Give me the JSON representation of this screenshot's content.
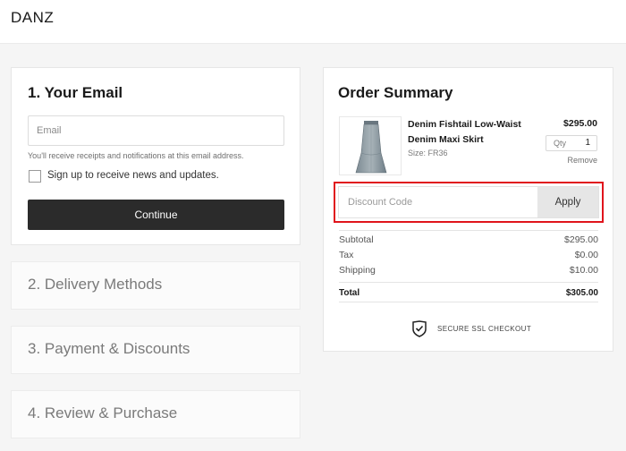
{
  "header": {
    "brand": "DANZ"
  },
  "checkout": {
    "email_step": {
      "title": "1.  Your Email",
      "email_placeholder": "Email",
      "email_value": "",
      "helper": "You'll receive receipts and notifications at this email address.",
      "newsletter_label": "Sign up to receive news and updates.",
      "newsletter_checked": false,
      "continue_label": "Continue"
    },
    "steps": [
      {
        "title": "2.  Delivery Methods"
      },
      {
        "title": "3.  Payment & Discounts"
      },
      {
        "title": "4.  Review & Purchase"
      }
    ]
  },
  "summary": {
    "title": "Order Summary",
    "item": {
      "name": "Denim Fishtail Low-Waist Denim Maxi Skirt",
      "size": "Size: FR36",
      "price": "$295.00",
      "qty_label": "Qty",
      "qty": "1",
      "remove_label": "Remove"
    },
    "discount": {
      "placeholder": "Discount Code",
      "apply_label": "Apply",
      "highlight_color": "#e0141c"
    },
    "totals": [
      {
        "label": "Subtotal",
        "value": "$295.00"
      },
      {
        "label": "Tax",
        "value": "$0.00"
      },
      {
        "label": "Shipping",
        "value": "$10.00"
      }
    ],
    "total": {
      "label": "Total",
      "value": "$305.00"
    },
    "ssl_label": "SECURE SSL CHECKOUT"
  }
}
